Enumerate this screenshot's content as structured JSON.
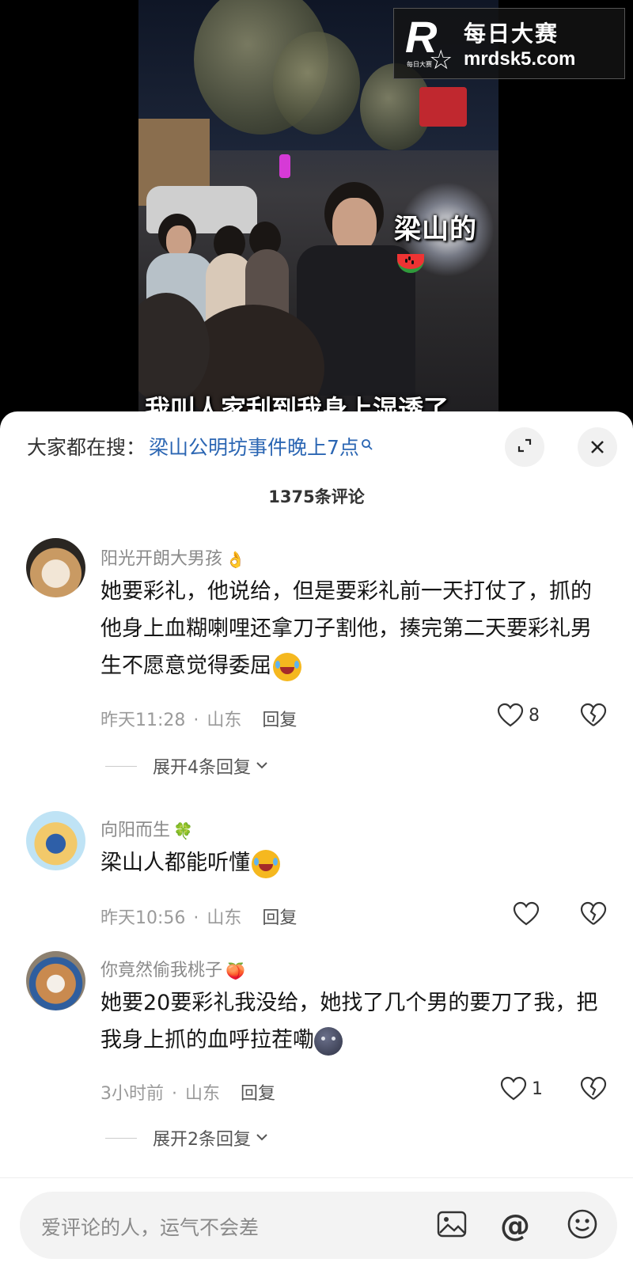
{
  "video": {
    "caption_top": "梁山的",
    "caption_bottom": "我叫人家刮到我身上湿透了"
  },
  "watermark": {
    "title": "每日大赛",
    "url": "mrdsk5.com",
    "logo_letter": "R",
    "logo_small": "每日大赛"
  },
  "comments_panel": {
    "search_prefix": "大家都在搜：",
    "search_query": "梁山公明坊事件晚上7点",
    "count_label": "1375条评论",
    "comments": [
      {
        "username": "阳光开朗大男孩",
        "name_emoji": "👌",
        "text": "她要彩礼，他说给，但是要彩礼前一天打仗了，抓的他身上血糊喇哩还拿刀子割他，揍完第二天要彩礼男生不愿意觉得委屈",
        "time": "昨天11:28",
        "location": "山东",
        "reply_label": "回复",
        "likes": "8",
        "expand_label": "展开4条回复"
      },
      {
        "username": "向阳而生",
        "name_emoji": "🍀",
        "text": "梁山人都能听懂",
        "time": "昨天10:56",
        "location": "山东",
        "reply_label": "回复",
        "likes": ""
      },
      {
        "username": "你竟然偷我桃子",
        "name_emoji": "🍑",
        "text": "她要20要彩礼我没给，她找了几个男的要刀了我，把我身上抓的血呼拉茬嘞",
        "time": "3小时前",
        "location": "山东",
        "reply_label": "回复",
        "likes": "1",
        "expand_label": "展开2条回复"
      }
    ],
    "input_placeholder": "爱评论的人，运气不会差"
  },
  "icons": {
    "expand": "expand-icon",
    "close": "close-icon",
    "like": "heart-icon",
    "dislike": "broken-heart-icon",
    "image": "image-icon",
    "mention": "at-icon",
    "emoji": "smiley-icon"
  },
  "colors": {
    "link": "#2b66b3",
    "meta": "#9a9a9a",
    "sheet_bg": "#ffffff"
  }
}
